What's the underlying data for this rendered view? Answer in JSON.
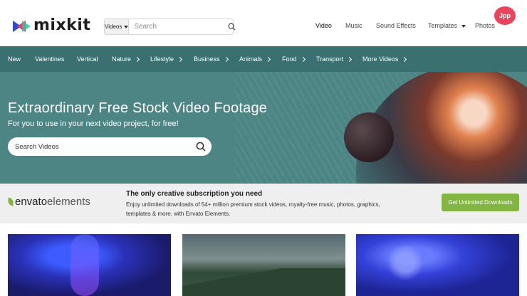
{
  "brand": {
    "name": "mixkit",
    "accent": "#3a7070",
    "green": "#82b541"
  },
  "header": {
    "search": {
      "type_label": "Videos",
      "placeholder": "Search"
    },
    "nav": {
      "video": "Video",
      "music": "Music",
      "sound_effects": "Sound Effects",
      "templates": "Templates",
      "photos": "Photos"
    },
    "badge": "Jpp"
  },
  "categories": [
    {
      "label": "New",
      "chevron": false
    },
    {
      "label": "Valentines",
      "chevron": false
    },
    {
      "label": "Vertical",
      "chevron": false
    },
    {
      "label": "Nature",
      "chevron": true
    },
    {
      "label": "Lifestyle",
      "chevron": true
    },
    {
      "label": "Business",
      "chevron": true
    },
    {
      "label": "Animals",
      "chevron": true
    },
    {
      "label": "Food",
      "chevron": true
    },
    {
      "label": "Transport",
      "chevron": true
    },
    {
      "label": "More Videos",
      "chevron": true
    }
  ],
  "hero": {
    "title": "Extraordinary Free Stock Video Footage",
    "subtitle": "For you to use in your next video project, for free!",
    "search_placeholder": "Search Videos"
  },
  "envato": {
    "logo_bold": "envato",
    "logo_light": "elements",
    "title": "The only creative subscription you need",
    "description": "Enjoy unlimited downloads of 54+ million premium stock videos, royalty-free music, photos, graphics, templates & more, with Envato Elements.",
    "button": "Get Unlimited Downloads"
  },
  "icons": {
    "search": "search-icon",
    "caret": "chevron-down-icon",
    "chevron": "chevron-right-icon",
    "envato": "leaf-icon"
  }
}
